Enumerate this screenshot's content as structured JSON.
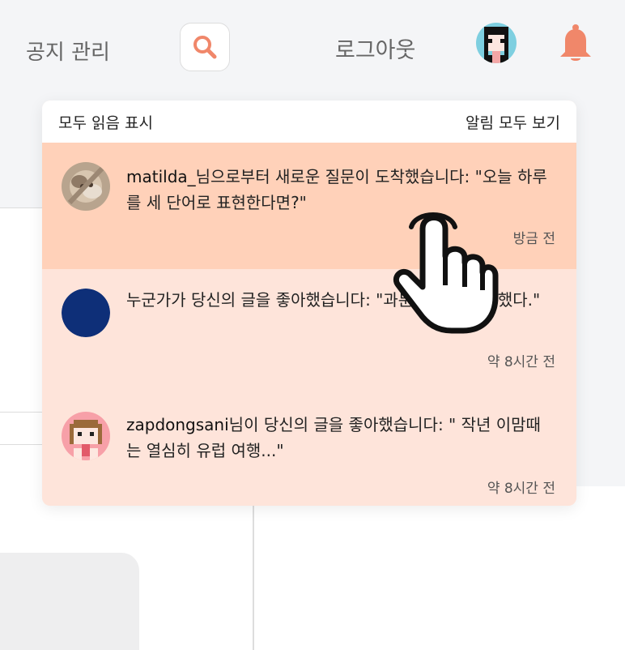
{
  "header": {
    "notice_label": "공지 관리",
    "logout_label": "로그아웃",
    "search_icon": "search-icon",
    "bell_icon": "bell-icon",
    "accent_color": "#f0876a"
  },
  "dropdown": {
    "mark_all_read": "모두 읽음 표시",
    "view_all": "알림 모두 보기",
    "unread_bg": "#ffd1b9",
    "read_bg": "#fee4da",
    "notifications": [
      {
        "user": "matilda_",
        "message": "님으로부터 새로운 질문이 도착했습니다: \"오늘 하루를 세 단어로 표현한다면?\"",
        "time": "방금 전",
        "unread": true
      },
      {
        "user": "",
        "message": "누군가가 당신의 글을 좋아했습니다: \"과분하기 전에 피했다.\"",
        "time": "약 8시간 전",
        "unread": false
      },
      {
        "user": "zapdongsani",
        "message": "님이 당신의 글을 좋아했습니다: \" 작년 이맘때는 열심히 유럽 여행...\"",
        "time": "약 8시간 전",
        "unread": false
      }
    ]
  }
}
